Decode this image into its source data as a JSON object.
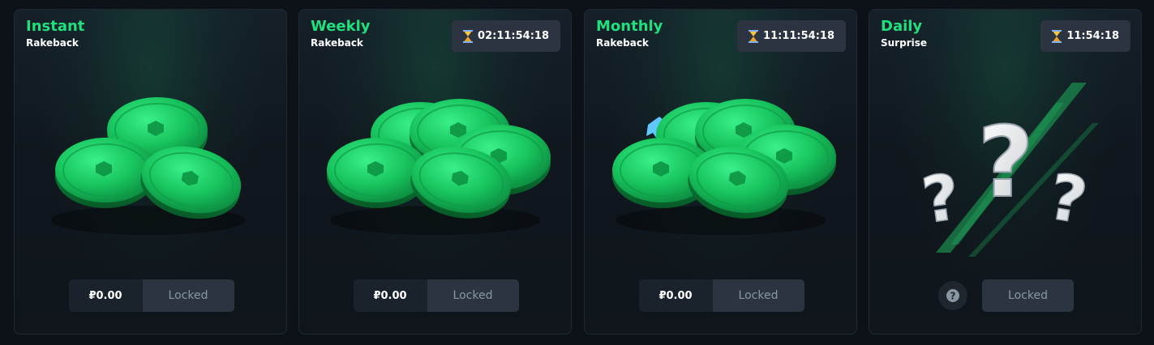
{
  "cards": [
    {
      "title": "Instant",
      "subtitle": "Rakeback",
      "amount": "₽0.00",
      "button": "Locked"
    },
    {
      "title": "Weekly",
      "subtitle": "Rakeback",
      "timer": "02:11:54:18",
      "amount": "₽0.00",
      "button": "Locked"
    },
    {
      "title": "Monthly",
      "subtitle": "Rakeback",
      "timer": "11:11:54:18",
      "amount": "₽0.00",
      "button": "Locked"
    },
    {
      "title": "Daily",
      "subtitle": "Surprise",
      "timer": "11:54:18",
      "button": "Locked"
    }
  ],
  "colors": {
    "accent": "#1fe07d",
    "card_bg": "#10171e",
    "button_bg": "#2b3542",
    "coin": "#14c25a"
  },
  "icons": [
    "hourglass-icon",
    "coins-illustration",
    "question-marks-illustration",
    "help-icon"
  ]
}
